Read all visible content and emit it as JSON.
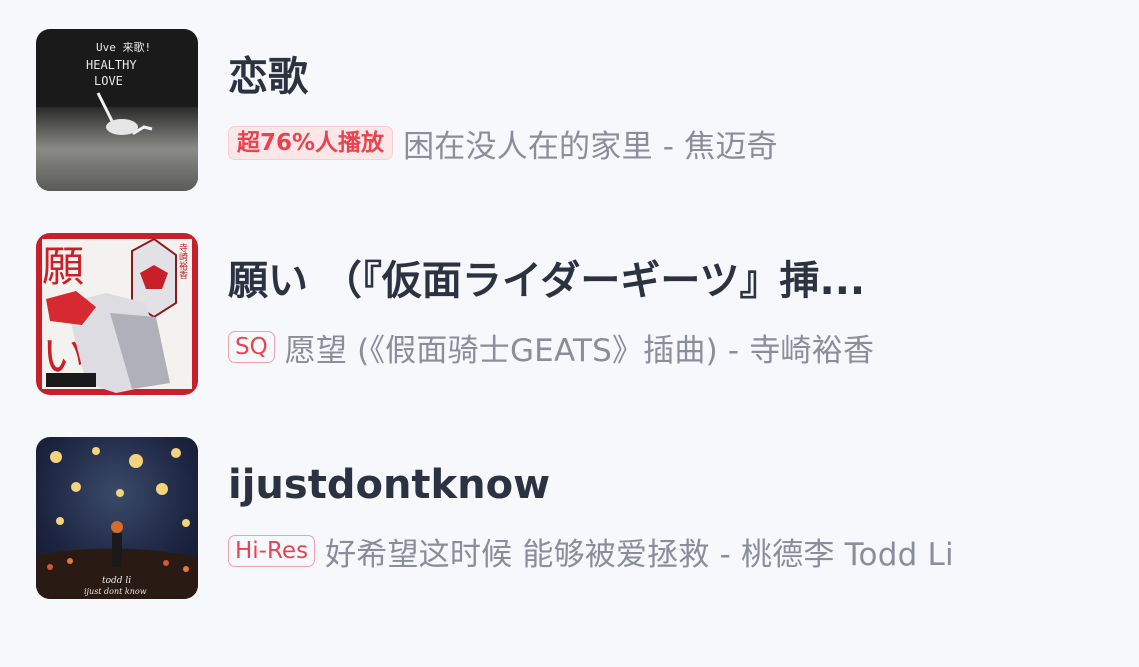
{
  "songs": [
    {
      "title": "恋歌",
      "badge": "超76%人播放",
      "subtitle": "困在没人在的家里 - 焦迈奇",
      "cover_icon": "album-cover-healthy-love",
      "cover_text": [
        "Uve 来歌!",
        "HEALTHY",
        "LOVE"
      ]
    },
    {
      "title": "願い （『仮面ライダーギーツ』挿...",
      "badge": "SQ",
      "subtitle": "愿望 (《假面骑士GEATS》插曲) - 寺崎裕香",
      "cover_icon": "album-cover-kamen-rider",
      "cover_text": [
        "願",
        "い",
        "寺崎裕香"
      ]
    },
    {
      "title": "ijustdontknow",
      "badge": "Hi-Res",
      "subtitle": "好希望这时候  能够被爱拯救 - 桃德李 Todd Li",
      "cover_icon": "album-cover-starry-night",
      "cover_text": [
        "todd li",
        "ijust dont know"
      ]
    }
  ],
  "colors": {
    "background": "#f7f8fc",
    "title": "#2d3242",
    "subtitle": "#8a8e9a",
    "badge": "#e8434e"
  }
}
